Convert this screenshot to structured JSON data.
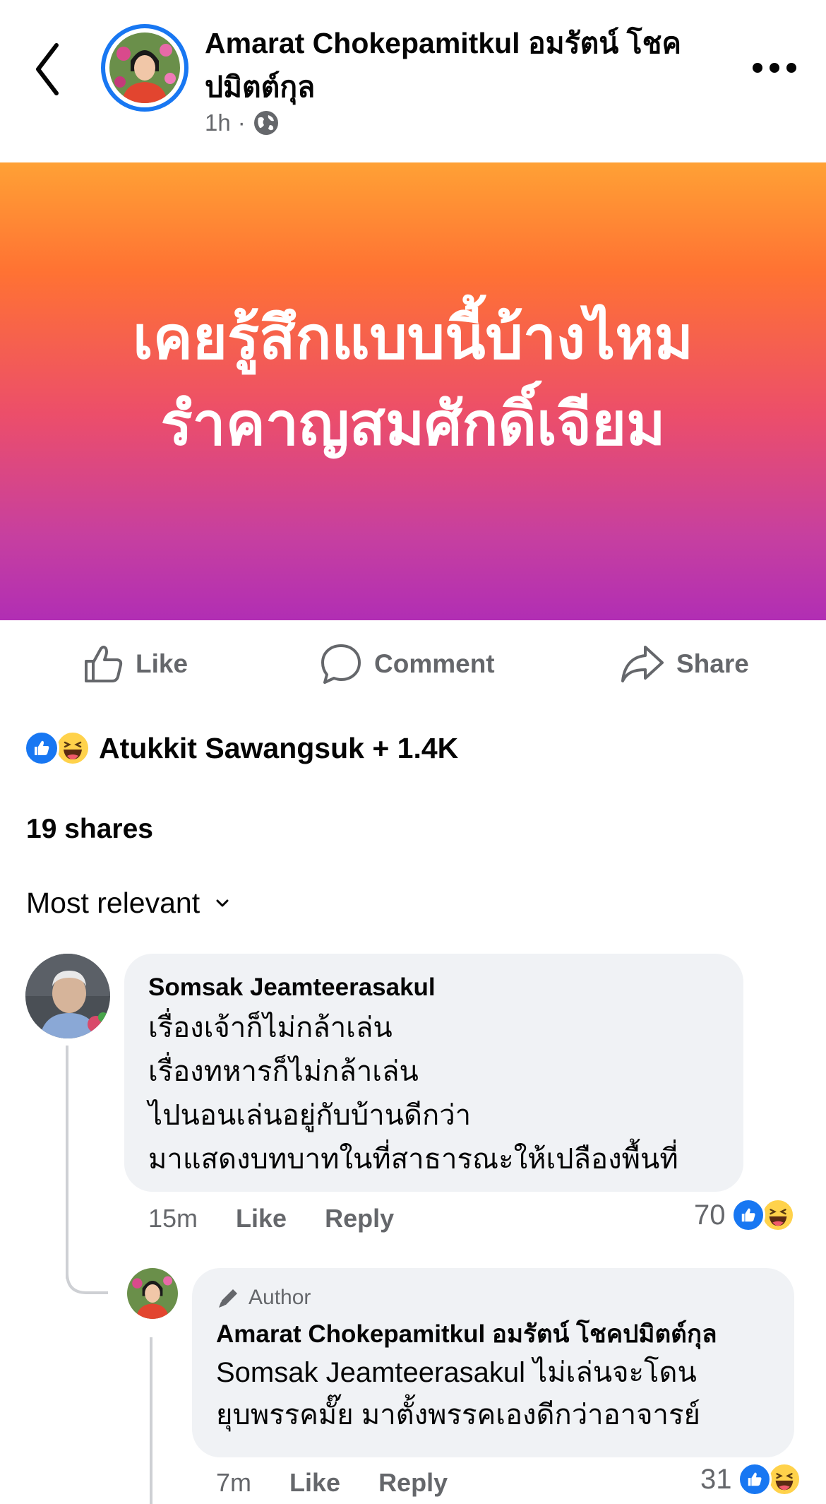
{
  "header": {
    "author_name": "Amarat Chokepamitkul อมรัตน์ โชคปมิตต์กุล",
    "time": "1h",
    "audience_icon": "globe-icon",
    "back_icon": "chevron-left-icon",
    "more_icon": "more-dots-icon"
  },
  "post": {
    "banner_text": "เคยรู้สึกแบบนี้บ้างไหม\nรำคาญสมศักดิ์เจียม",
    "banner_colors": [
      "#ffa135",
      "#ff7233",
      "#ec4e6a",
      "#b12eb4"
    ]
  },
  "actions": {
    "like_label": "Like",
    "comment_label": "Comment",
    "share_label": "Share"
  },
  "reactions": {
    "summary": "Atukkit Sawangsuk + 1.4K",
    "types": [
      "like",
      "haha"
    ]
  },
  "shares": "19 shares",
  "sort": {
    "label": "Most relevant"
  },
  "comments": [
    {
      "name": "Somsak Jeamteerasakul",
      "text": "เรื่องเจ้าก็ไม่กล้าเล่น\nเรื่องทหารก็ไม่กล้าเล่น\nไปนอนเล่นอยู่กับบ้านดีกว่า\nมาแสดงบทบาทในที่สาธารณะให้เปลืองพื้นที่",
      "time": "15m",
      "like_label": "Like",
      "reply_label": "Reply",
      "reaction_count": "70",
      "replies": [
        {
          "badge": "Author",
          "name": "Amarat Chokepamitkul อมรัตน์ โชคปมิตต์กุล",
          "text": "Somsak Jeamteerasakul ไม่เล่นจะโดน\nยุบพรรคมั๊ย มาตั้งพรรคเองดีกว่าอาจารย์",
          "time": "7m",
          "like_label": "Like",
          "reply_label": "Reply",
          "reaction_count": "31"
        }
      ]
    }
  ],
  "colors": {
    "accent": "#1877f2",
    "secondary_text": "#65676b",
    "bubble": "#f0f2f5"
  }
}
